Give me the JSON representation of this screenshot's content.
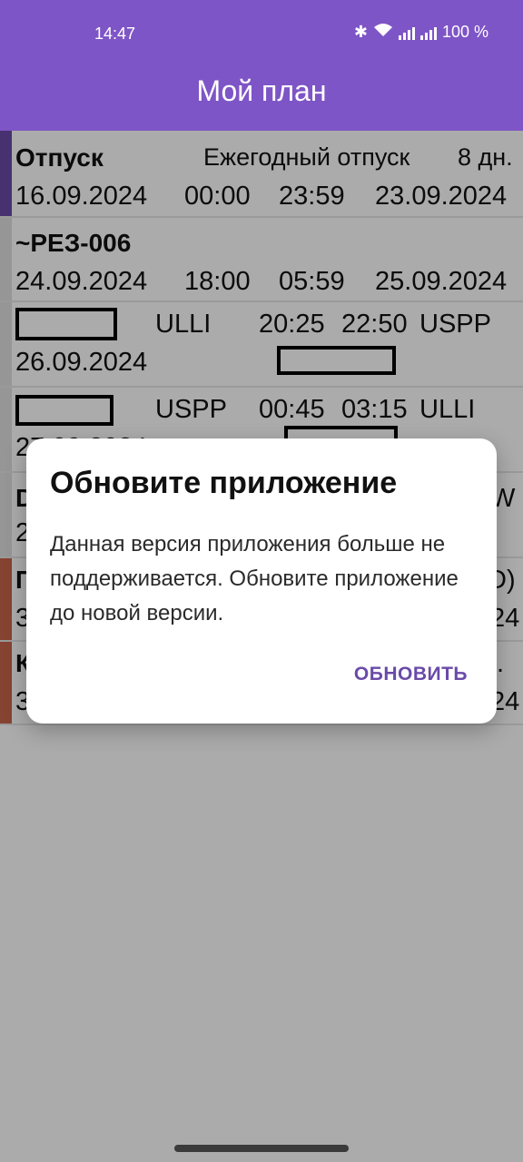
{
  "status_bar": {
    "time": "14:47",
    "battery": "100 %"
  },
  "app_bar": {
    "title": "Мой план"
  },
  "list": {
    "rows": [
      {
        "title": "Отпуск",
        "type": "Ежегодный отпуск",
        "duration": "8 дн.",
        "date_start": "16.09.2024",
        "time_start": "00:00",
        "time_end": "23:59",
        "date_end": "23.09.2024",
        "stripe": "#7e55c6"
      },
      {
        "title": "~РЕЗ-006",
        "date_start": "24.09.2024",
        "time_start": "18:00",
        "time_end": "05:59",
        "date_end": "25.09.2024"
      },
      {
        "from": "ULLI",
        "dep": "20:25",
        "arr": "22:50",
        "to": "USPP",
        "date": "26.09.2024"
      },
      {
        "from": "USPP",
        "dep": "00:45",
        "arr": "03:15",
        "to": "ULLI",
        "date": "27.09.2024"
      },
      {
        "lead": "D",
        "date_lead": "2",
        "tail": "W"
      },
      {
        "lead": "П",
        "date_lead": "3",
        "tail": "D)",
        "date_tail": "24",
        "stripe": "#c0553a"
      },
      {
        "lead": "К",
        "date_lead": "3",
        "tail": ".",
        "date_tail": "24",
        "stripe": "#c0553a"
      }
    ]
  },
  "dialog": {
    "title": "Обновите приложение",
    "message": "Данная версия приложения больше не поддерживается. Обновите приложение до новой версии.",
    "button": "ОБНОВИТЬ"
  }
}
